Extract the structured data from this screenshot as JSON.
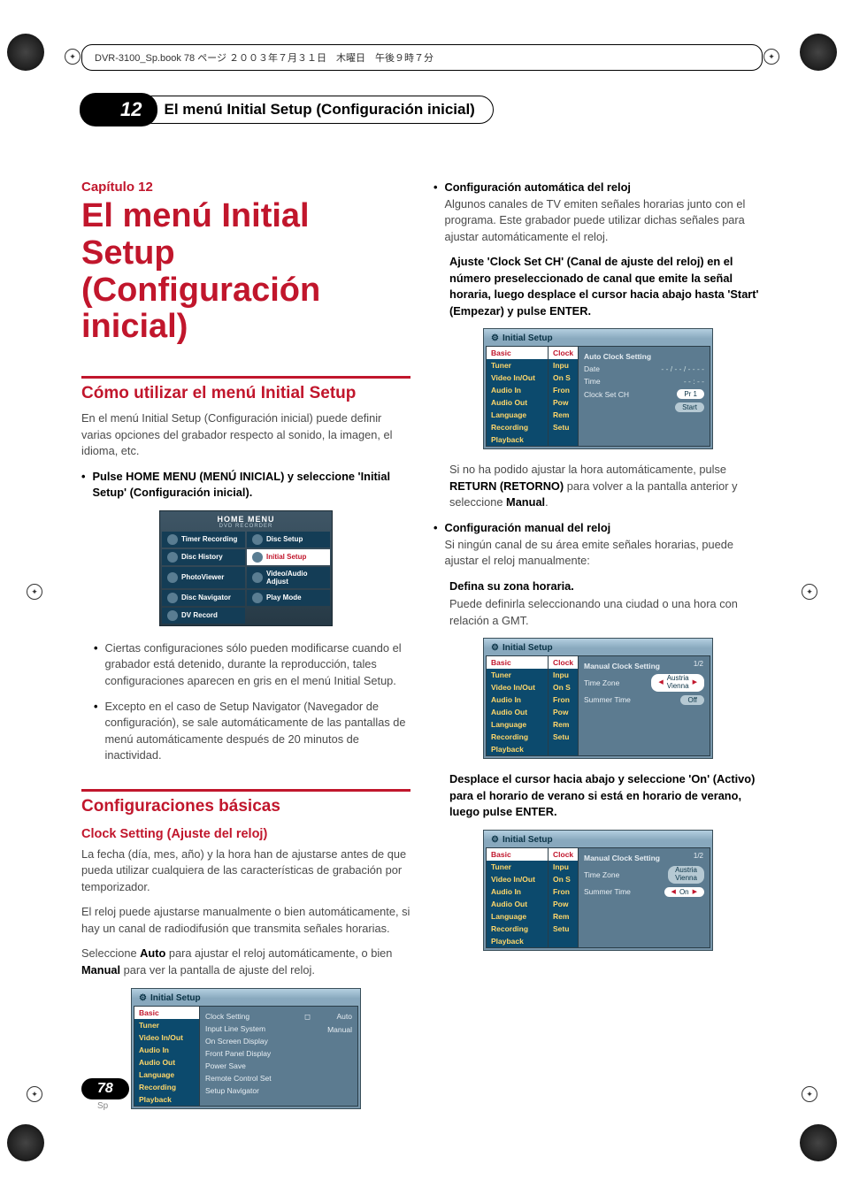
{
  "doc_bar": "DVR-3100_Sp.book  78 ページ  ２００３年７月３１日　木曜日　午後９時７分",
  "header": {
    "chapter_tab": "12",
    "section_pill": "El menú Initial Setup (Configuración inicial)"
  },
  "chapter": {
    "label": "Capítulo 12",
    "title": "El menú Initial Setup (Configuración inicial)"
  },
  "left": {
    "h2a": "Cómo utilizar el menú Initial Setup",
    "p1": "En el menú Initial Setup (Configuración inicial) puede definir varias opciones del grabador respecto al sonido, la imagen, el idioma, etc.",
    "bullet1_bold": "Pulse HOME MENU (MENÚ INICIAL) y seleccione 'Initial Setup' (Configuración inicial).",
    "home_menu": {
      "title": "HOME MENU",
      "sub": "DVD RECORDER",
      "items": [
        [
          "Timer Recording",
          "Disc Setup"
        ],
        [
          "Disc History",
          "Initial Setup"
        ],
        [
          "PhotoViewer",
          "Video/Audio Adjust"
        ],
        [
          "Disc Navigator",
          "Play Mode"
        ],
        [
          "DV Record",
          ""
        ]
      ],
      "highlight": "Initial Setup"
    },
    "sub_bullet1": "Ciertas configuraciones sólo pueden modificarse cuando el grabador está detenido, durante la reproducción, tales configuraciones aparecen en gris en el menú Initial Setup.",
    "sub_bullet2": "Excepto en el caso de Setup Navigator (Navegador de configuración), se sale automáticamente de las pantallas de menú automáticamente después de 20 minutos de inactividad.",
    "h2b": "Configuraciones básicas",
    "h3a": "Clock Setting (Ajuste del reloj)",
    "p2": "La fecha (día, mes, año) y la hora han de ajustarse antes de que pueda utilizar cualquiera de las características de grabación por temporizador.",
    "p3": "El reloj puede ajustarse manualmente o bien automáticamente, si hay un canal de radiodifusión que transmita señales horarias.",
    "p4_prefix": "Seleccione ",
    "p4_b1": "Auto",
    "p4_mid": " para ajustar el reloj automáticamente, o bien ",
    "p4_b2": "Manual",
    "p4_suffix": " para ver la pantalla de ajuste del reloj.",
    "osd1": {
      "title": "Initial Setup",
      "sidebar": [
        "Basic",
        "Tuner",
        "Video In/Out",
        "Audio In",
        "Audio Out",
        "Language",
        "Recording",
        "Playback"
      ],
      "menu": [
        "Clock Setting",
        "Input Line System",
        "On Screen Display",
        "Front Panel Display",
        "Power Save",
        "Remote Control Set",
        "Setup Navigator"
      ],
      "opts": [
        "Auto",
        "Manual"
      ],
      "opt_marker": "◻"
    }
  },
  "right": {
    "bullet_heading1": "Configuración automática del reloj",
    "p_r1": "Algunos canales de TV emiten señales horarias junto con el programa. Este grabador puede utilizar dichas señales para ajustar automáticamente el reloj.",
    "bold_r1": "Ajuste 'Clock Set CH' (Canal de ajuste del reloj) en el número preseleccionado de canal que emite la señal horaria, luego desplace el cursor hacia abajo hasta 'Start' (Empezar) y pulse  ENTER.",
    "osd2": {
      "title": "Initial Setup",
      "sidebar": [
        "Basic",
        "Tuner",
        "Video In/Out",
        "Audio In",
        "Audio Out",
        "Language",
        "Recording",
        "Playback"
      ],
      "alt": [
        "Clock",
        "Inpu",
        "On S",
        "Fron",
        "Pow",
        "Rem",
        "Setu"
      ],
      "heading": "Auto Clock Setting",
      "rows": [
        {
          "k": "Date",
          "v": "- - / - - / - - - -"
        },
        {
          "k": "Time",
          "v": "- - : - -"
        },
        {
          "k": "Clock Set CH",
          "chip": "Pr 1"
        },
        {
          "k": "",
          "chip": "Start"
        }
      ]
    },
    "p_r2_prefix": "Si no ha podido ajustar la hora automáticamente, pulse ",
    "p_r2_b": "RETURN (RETORNO)",
    "p_r2_mid": " para volver a la pantalla anterior y seleccione ",
    "p_r2_b2": "Manual",
    "p_r2_suffix": ".",
    "bullet_heading2": "Configuración manual del reloj",
    "p_r3": "Si ningún canal de su área emite señales horarias, puede ajustar el reloj manualmente:",
    "bold_r2": "Defina su zona horaria.",
    "p_r4": "Puede definirla seleccionando una ciudad o una hora con relación a GMT.",
    "osd3": {
      "title": "Initial Setup",
      "sidebar": [
        "Basic",
        "Tuner",
        "Video In/Out",
        "Audio In",
        "Audio Out",
        "Language",
        "Recording",
        "Playback"
      ],
      "alt": [
        "Clock",
        "Inpu",
        "On S",
        "Fron",
        "Pow",
        "Rem",
        "Setu"
      ],
      "heading": "Manual Clock Setting",
      "page": "1/2",
      "rows": [
        {
          "k": "Time Zone",
          "chip_sel": "Austria\nVienna"
        },
        {
          "k": "Summer Time",
          "chip": "Off"
        }
      ]
    },
    "bold_r3": "Desplace el cursor hacia abajo y seleccione 'On' (Activo) para el horario de verano si está en horario de verano, luego pulse ENTER.",
    "osd4": {
      "title": "Initial Setup",
      "sidebar": [
        "Basic",
        "Tuner",
        "Video In/Out",
        "Audio In",
        "Audio Out",
        "Language",
        "Recording",
        "Playback"
      ],
      "alt": [
        "Clock",
        "Inpu",
        "On S",
        "Fron",
        "Pow",
        "Rem",
        "Setu"
      ],
      "heading": "Manual Clock Setting",
      "page": "1/2",
      "rows": [
        {
          "k": "Time Zone",
          "chip": "Austria\nVienna"
        },
        {
          "k": "Summer Time",
          "chip_sel": "On"
        }
      ]
    }
  },
  "footer": {
    "page": "78",
    "lang": "Sp"
  }
}
